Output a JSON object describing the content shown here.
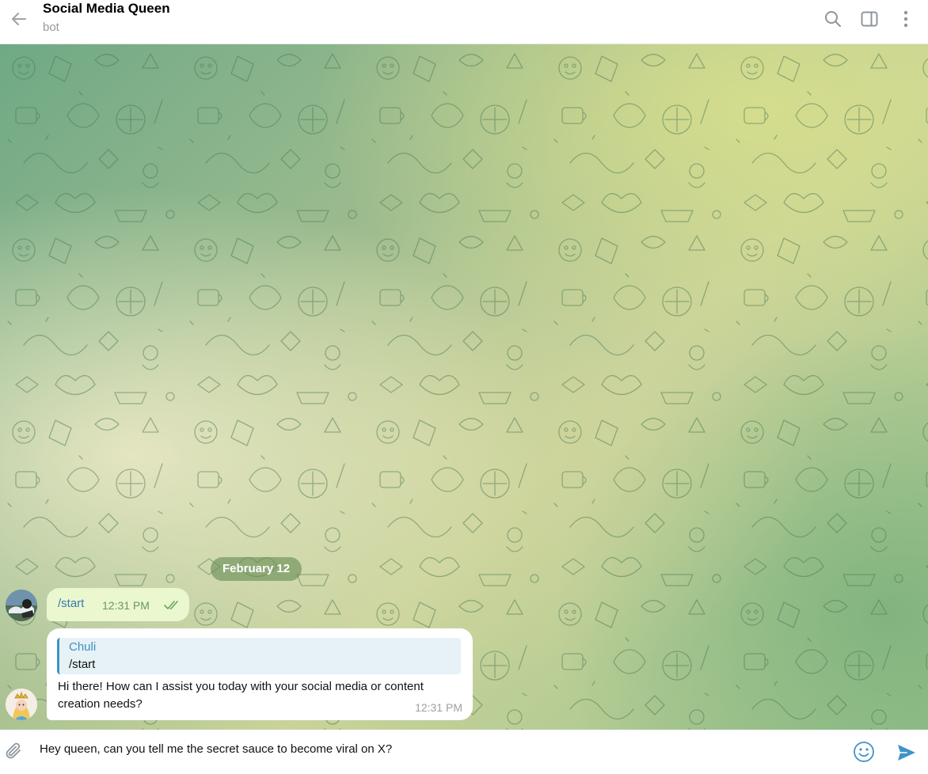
{
  "header": {
    "title": "Social Media Queen",
    "subtitle": "bot",
    "back_icon": "arrow-left-icon",
    "actions": [
      "search-icon",
      "sidebar-toggle-icon",
      "more-vertical-icon"
    ]
  },
  "chat": {
    "date_separator": "February 12",
    "messages": [
      {
        "direction": "outgoing",
        "text": "/start",
        "time": "12:31 PM",
        "status": "read"
      },
      {
        "direction": "incoming",
        "reply_to": {
          "author": "Chuli",
          "text": "/start"
        },
        "text": "Hi there! How can I assist you today with your social media or content creation needs?",
        "time": "12:31 PM"
      }
    ]
  },
  "composer": {
    "value": "Hey queen, can you tell me the secret sauce to become viral on X?",
    "attach_icon": "paperclip-icon",
    "emoji_icon": "smiley-icon",
    "send_icon": "send-icon"
  },
  "colors": {
    "accent": "#3f93c8",
    "outgoing_bubble": "#eaf7cf",
    "incoming_bubble": "#ffffff",
    "date_pill": "#6f8f5e"
  }
}
